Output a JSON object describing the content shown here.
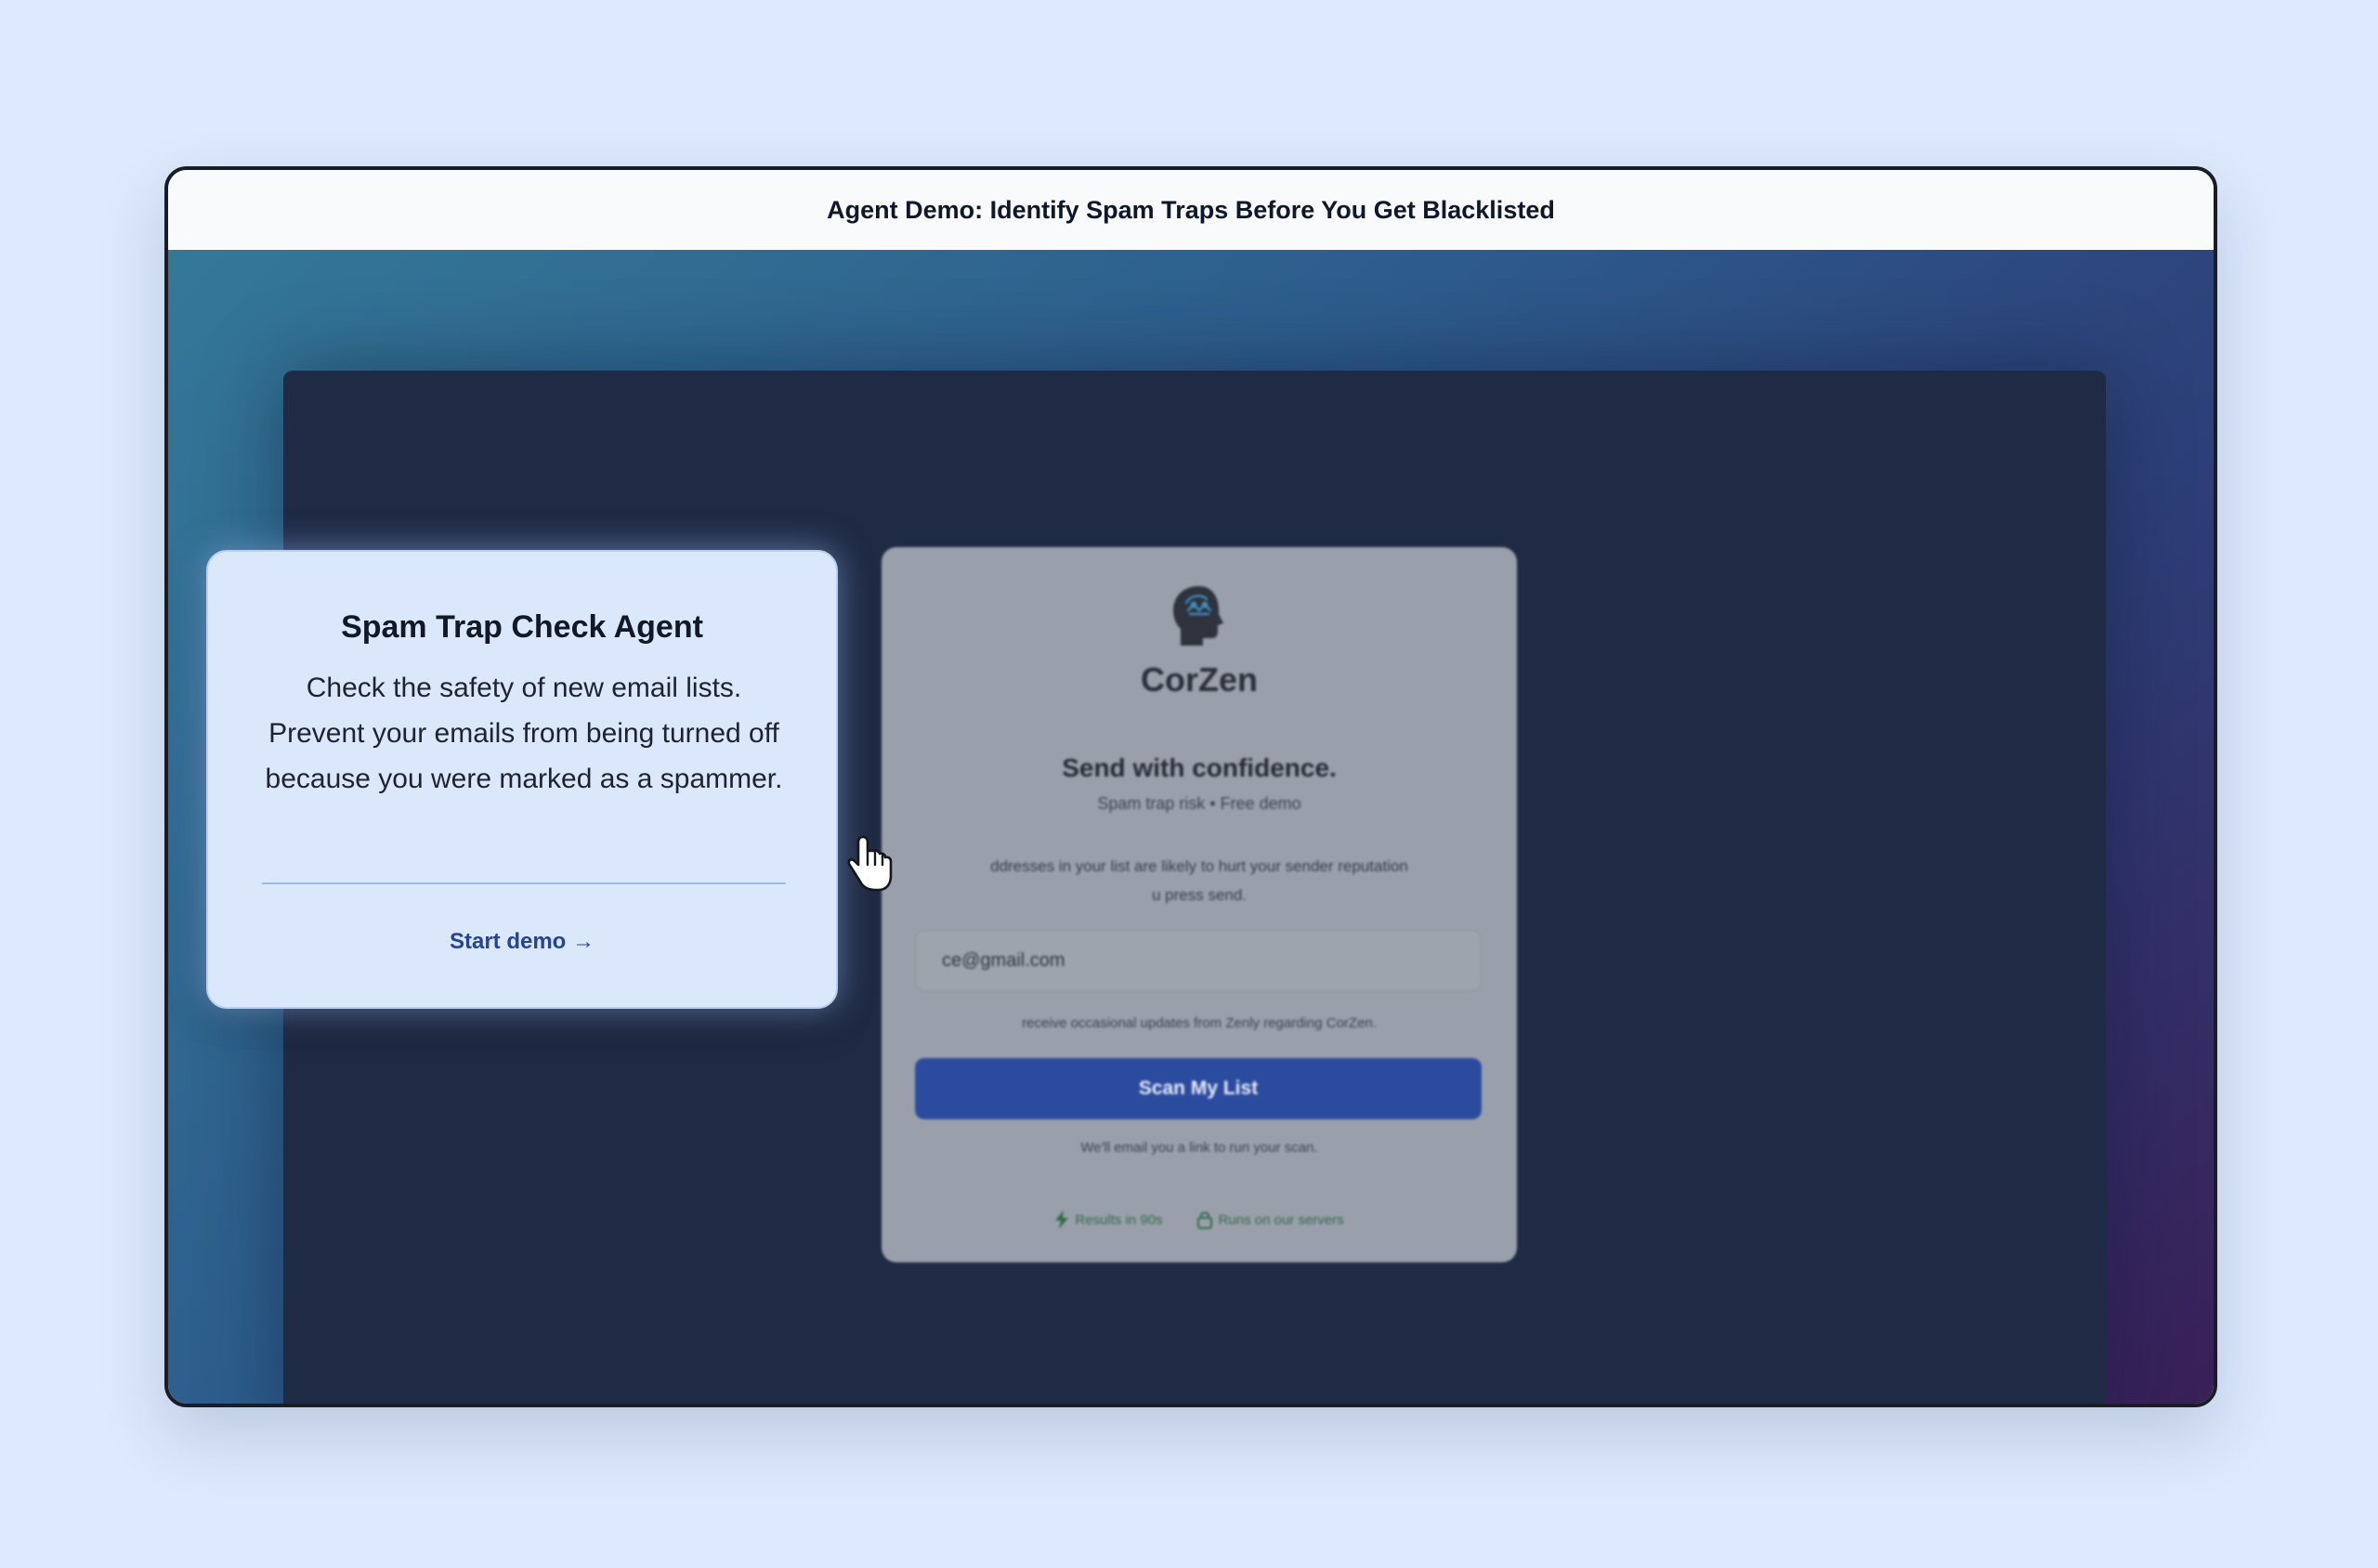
{
  "window": {
    "title": "Agent Demo: Identify Spam Traps Before You Get Blacklisted"
  },
  "signup_card": {
    "logo_icon": "head-brain-icon",
    "brand_name": "CorZen",
    "heading": "Send with confidence.",
    "subheading": "Spam trap risk • Free demo",
    "description": "ddresses in your list are likely to hurt your sender reputation\nu press send.",
    "email_value": "ce@gmail.com",
    "consent_note": "receive occasional updates from Zenly regarding CorZen.",
    "scan_button_label": "Scan My List",
    "email_link_note": "We'll email you a link to run your scan.",
    "badges": [
      {
        "icon": "lightning-icon",
        "label": "Results in 90s"
      },
      {
        "icon": "lock-icon",
        "label": "Runs on our servers"
      }
    ]
  },
  "popover": {
    "title": "Spam Trap Check Agent",
    "description": "Check the safety of new email lists. Prevent your emails from being turned off because you were marked as a spammer.",
    "cta_label": "Start demo →"
  },
  "colors": {
    "page_background": "#dde9fc",
    "primary_button": "#2b4c9e",
    "cta_text": "#24449c",
    "badge_text": "#2f6a47"
  }
}
